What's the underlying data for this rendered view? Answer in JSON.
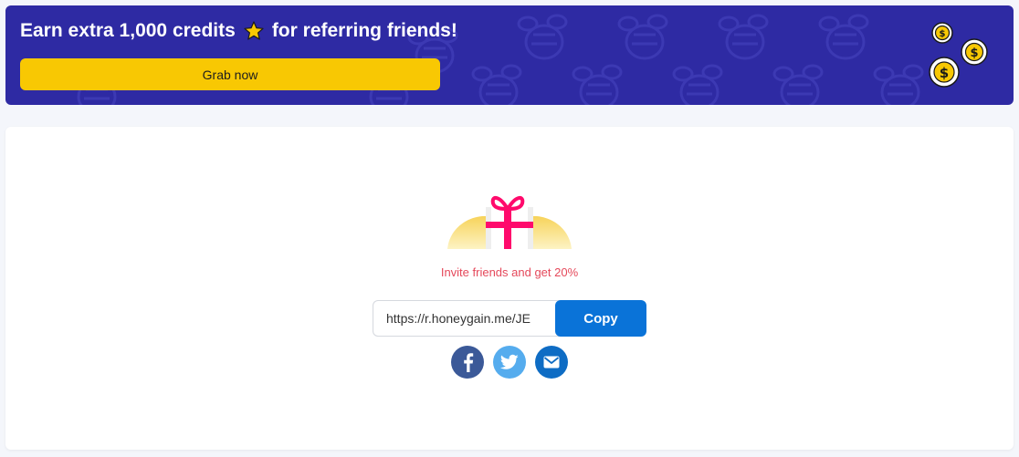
{
  "banner": {
    "title_prefix": "Earn extra 1,000 credits",
    "title_suffix": "for referring friends!",
    "button_label": "Grab now",
    "icons": [
      "star-icon",
      "coins-icon",
      "bee-pattern"
    ]
  },
  "referral": {
    "message": "Invite friends and get 20%",
    "link_value": "https://r.honeygain.me/JE",
    "copy_label": "Copy",
    "share": [
      {
        "name": "facebook",
        "icon": "facebook-icon"
      },
      {
        "name": "twitter",
        "icon": "twitter-icon"
      },
      {
        "name": "email",
        "icon": "mail-icon"
      }
    ]
  },
  "colors": {
    "banner_bg": "#2e2aa3",
    "grab_button": "#f8c803",
    "copy_button": "#0a73d8",
    "invite_text": "#e5495b",
    "facebook": "#3b5998",
    "twitter": "#55acee",
    "email": "#0e6cc4"
  }
}
